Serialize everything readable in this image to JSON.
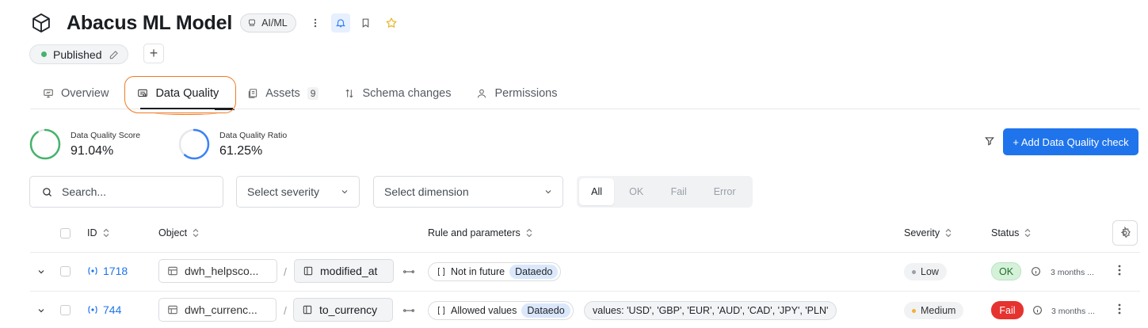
{
  "header": {
    "title": "Abacus ML Model",
    "tag_label": "AI/ML",
    "status_label": "Published",
    "add_label": "+"
  },
  "tabs": [
    {
      "label": "Overview"
    },
    {
      "label": "Data Quality"
    },
    {
      "label": "Assets",
      "badge": "9"
    },
    {
      "label": "Schema changes"
    },
    {
      "label": "Permissions"
    }
  ],
  "metrics": {
    "score_label": "Data Quality Score",
    "score_value": "91.04%",
    "score_fraction": 0.9104,
    "ratio_label": "Data Quality Ratio",
    "ratio_value": "61.25%",
    "ratio_fraction": 0.6125
  },
  "actions": {
    "add_check_label": "+ Add Data Quality check"
  },
  "filters": {
    "search_placeholder": "Search...",
    "severity_placeholder": "Select severity",
    "dimension_placeholder": "Select dimension",
    "status_segments": [
      "All",
      "OK",
      "Fail",
      "Error"
    ],
    "active_segment": "All"
  },
  "table": {
    "columns": [
      "ID",
      "Object",
      "Rule and parameters",
      "Severity",
      "Status"
    ],
    "rows": [
      {
        "id": "1718",
        "object": "dwh_helpsco...",
        "column": "modified_at",
        "rule": "Not in future",
        "source": "Dataedo",
        "params": "",
        "severity": "Low",
        "status": "OK",
        "when": "3 months ..."
      },
      {
        "id": "744",
        "object": "dwh_currenc...",
        "column": "to_currency",
        "rule": "Allowed values",
        "source": "Dataedo",
        "params": "values: 'USD', 'GBP', 'EUR', 'AUD', 'CAD', 'JPY', 'PLN'",
        "severity": "Medium",
        "status": "Fail",
        "when": "3 months ..."
      }
    ]
  },
  "colors": {
    "accent": "#1f74ec",
    "score_ring": "#45b36b",
    "ratio_ring": "#3b82f6",
    "severity_low": "#9aa0a8",
    "severity_medium": "#f2b233",
    "status_ok_bg": "#d6f1d9",
    "status_fail_bg": "#e5332f",
    "annotation": "#f07a23"
  }
}
